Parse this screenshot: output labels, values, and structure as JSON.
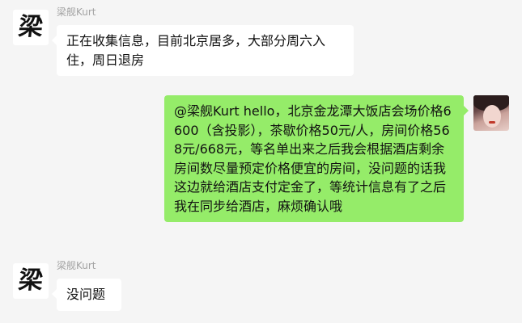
{
  "messages": [
    {
      "sender": "梁舰Kurt",
      "side": "left",
      "avatar_text": "梁",
      "text": "正在收集信息，目前北京居多，大部分周六入住，周日退房"
    },
    {
      "sender": "",
      "side": "right",
      "avatar_text": "",
      "text": "@梁舰Kurt hello，北京金龙潭大饭店会场价格6600（含投影），茶歇价格50元/人，房间价格568元/668元，等名单出来之后我会根据酒店剩余房间数尽量预定价格便宜的房间，没问题的话我这边就给酒店支付定金了，等统计信息有了之后我在同步给酒店，麻烦确认哦"
    },
    {
      "sender": "梁舰Kurt",
      "side": "left",
      "avatar_text": "梁",
      "text": "没问题"
    }
  ],
  "colors": {
    "background": "#f5f5f5",
    "left_bubble": "#ffffff",
    "right_bubble": "#95ec69",
    "sender_name": "#a3a3a3"
  }
}
